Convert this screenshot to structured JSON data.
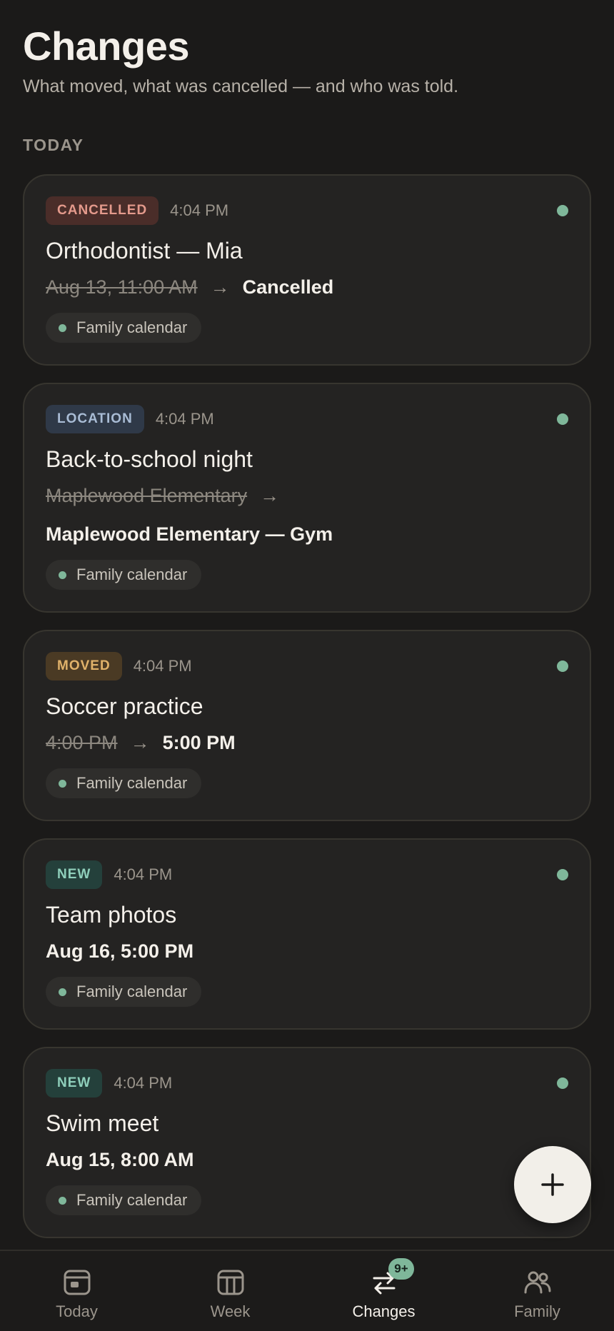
{
  "header": {
    "title": "Changes",
    "subtitle": "What moved, what was cancelled — and who was told."
  },
  "section": {
    "label": "TODAY"
  },
  "cards": [
    {
      "badge": "CANCELLED",
      "time": "4:04 PM",
      "title": "Orthodontist — Mia",
      "old": "Aug 13, 11:00 AM",
      "arrow": "→",
      "new": "Cancelled",
      "calendar": "Family calendar"
    },
    {
      "badge": "LOCATION",
      "time": "4:04 PM",
      "title": "Back-to-school night",
      "old": "Maplewood Elementary",
      "arrow": "→",
      "new": "Maplewood Elementary — Gym",
      "calendar": "Family calendar"
    },
    {
      "badge": "MOVED",
      "time": "4:04 PM",
      "title": "Soccer practice",
      "old": "4:00 PM",
      "arrow": "→",
      "new": "5:00 PM",
      "calendar": "Family calendar"
    },
    {
      "badge": "NEW",
      "time": "4:04 PM",
      "title": "Team photos",
      "new": "Aug 16, 5:00 PM",
      "calendar": "Family calendar"
    },
    {
      "badge": "NEW",
      "time": "4:04 PM",
      "title": "Swim meet",
      "new": "Aug 15, 8:00 AM",
      "calendar": "Family calendar"
    }
  ],
  "fab": {
    "icon": "plus-icon"
  },
  "tabs": [
    {
      "label": "Today",
      "icon": "today-calendar-icon"
    },
    {
      "label": "Week",
      "icon": "week-grid-icon"
    },
    {
      "label": "Changes",
      "icon": "swap-arrows-icon",
      "badge": "9+",
      "active": true
    },
    {
      "label": "Family",
      "icon": "people-icon"
    }
  ],
  "colors": {
    "background": "#1b1a19",
    "card": "#242322",
    "accent_green": "#7fb79a",
    "cancelled": "#e49a8c",
    "location": "#a9bcd5",
    "moved": "#e0b26a",
    "new": "#8fcfbb"
  }
}
